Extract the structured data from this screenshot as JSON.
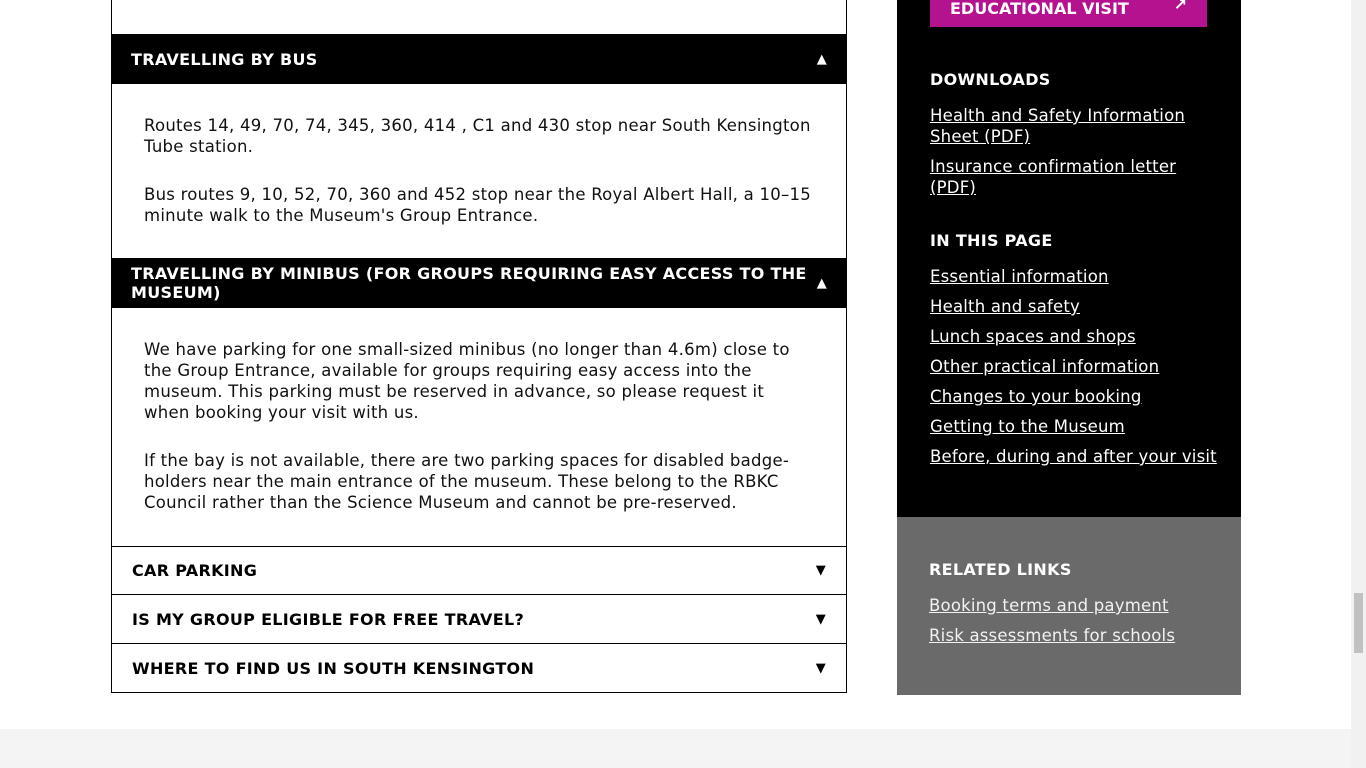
{
  "accordion": {
    "bus": {
      "title": "TRAVELLING BY BUS",
      "arrow": "▲",
      "paragraphs": [
        "Routes 14, 49, 70, 74, 345, 360, 414 , C1 and 430 stop near South Kensington Tube station.",
        "Bus routes 9, 10, 52, 70, 360 and 452 stop near the Royal Albert Hall, a 10–15 minute walk to the Museum's Group Entrance."
      ]
    },
    "minibus": {
      "title": "TRAVELLING BY MINIBUS (FOR GROUPS REQUIRING EASY ACCESS TO THE MUSEUM)",
      "arrow": "▲",
      "paragraphs": [
        "We have parking for one small-sized minibus (no longer than 4.6m) close to the Group Entrance, available for groups requiring easy access into the museum. This parking must be reserved in advance, so please request it when booking your visit with us.",
        "If the bay is not available, there are two parking spaces for disabled badge-holders near the main entrance of the museum. These belong to the RBKC Council rather than the Science Museum and cannot be pre-reserved."
      ]
    },
    "car_parking": {
      "title": "CAR PARKING",
      "arrow": "▼"
    },
    "free_travel": {
      "title": "IS MY GROUP ELIGIBLE FOR FREE TRAVEL?",
      "arrow": "▼"
    },
    "find_us": {
      "title": "WHERE TO FIND US IN SOUTH KENSINGTON",
      "arrow": "▼"
    }
  },
  "sidebar": {
    "book_button": {
      "label": "EDUCATIONAL VISIT",
      "arrow_icon": "↗",
      "color": "#b5128f"
    },
    "downloads": {
      "heading": "DOWNLOADS",
      "links": [
        "Health and Safety Information Sheet (PDF)",
        "Insurance confirmation letter (PDF)"
      ]
    },
    "in_this_page": {
      "heading": "IN THIS PAGE",
      "links": [
        "Essential information",
        "Health and safety",
        "Lunch spaces and shops",
        "Other practical information",
        "Changes to your booking",
        "Getting to the Museum",
        "Before, during and after your visit"
      ]
    },
    "related": {
      "heading": "RELATED LINKS",
      "links": [
        "Booking terms and payment",
        "Risk assessments for schools"
      ]
    }
  }
}
